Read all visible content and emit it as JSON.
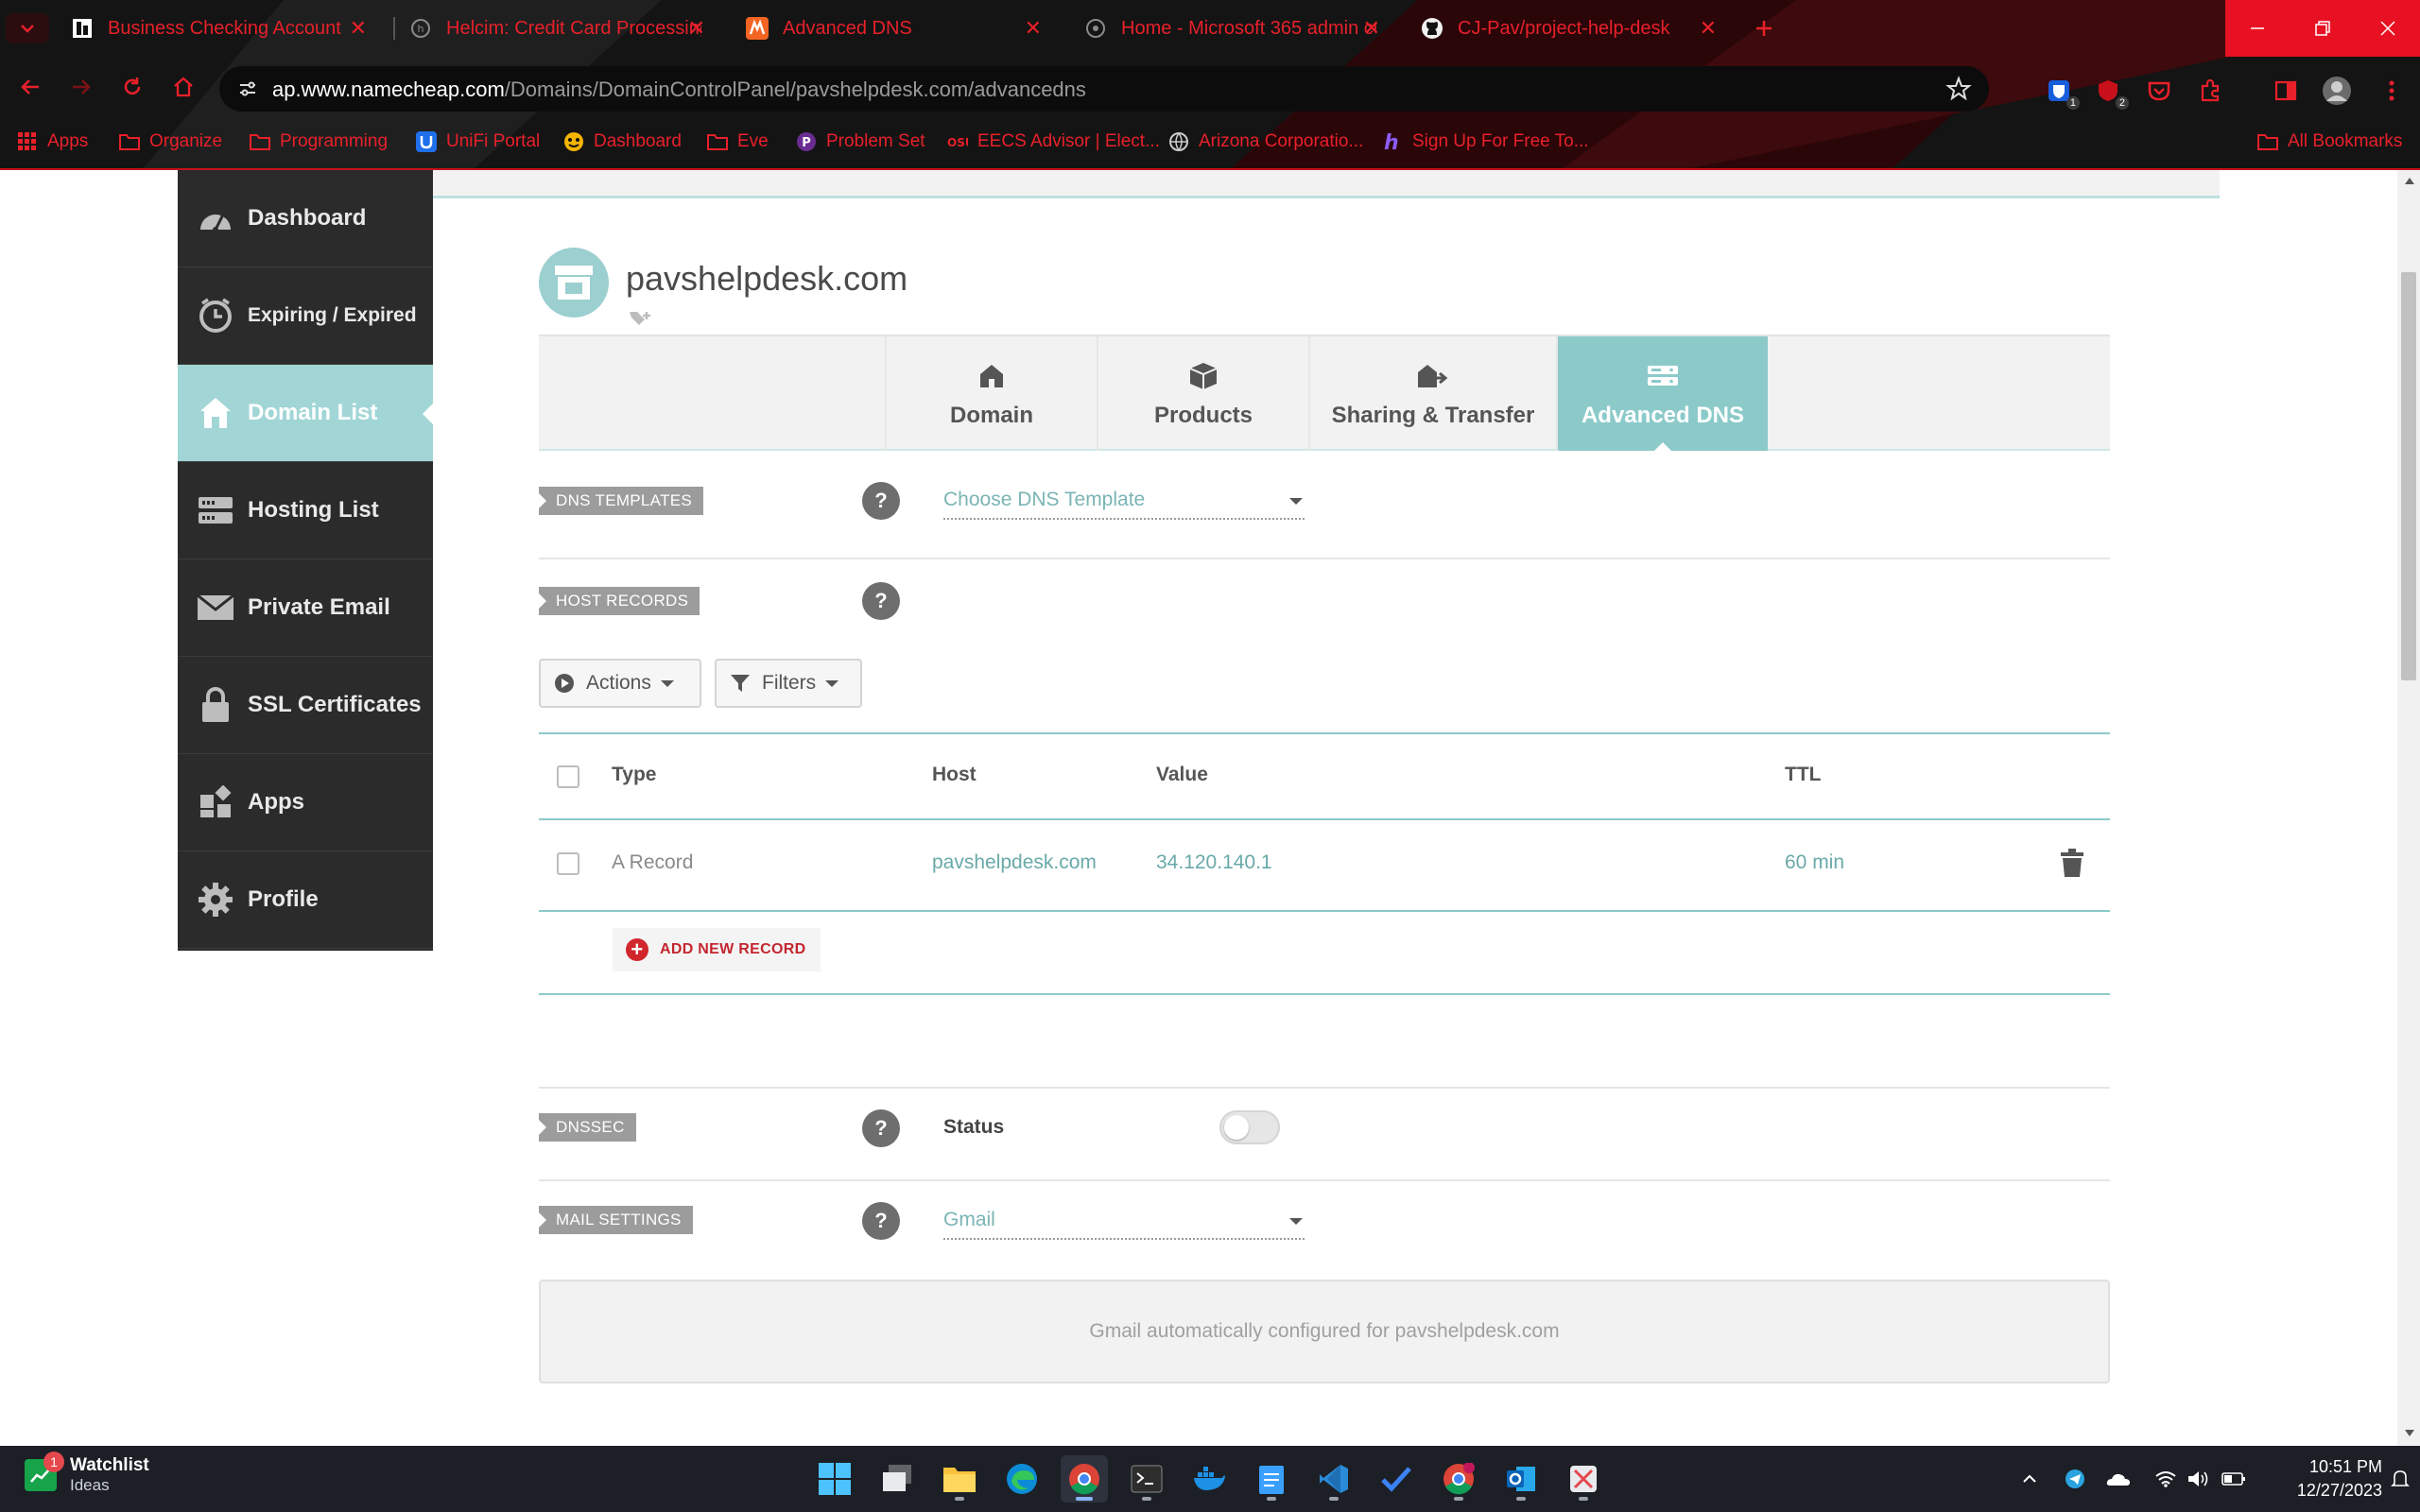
{
  "browser": {
    "tabs": [
      {
        "title": "Business Checking Account",
        "icon": "bank-favicon",
        "active": false
      },
      {
        "title": "Helcim: Credit Card Processing",
        "icon": "helcim-favicon",
        "active": false
      },
      {
        "title": "Advanced DNS",
        "icon": "namecheap-favicon",
        "active": true
      },
      {
        "title": "Home - Microsoft 365 admin ce",
        "icon": "microsoft-admin-favicon",
        "active": false
      },
      {
        "title": "CJ-Pav/project-help-desk",
        "icon": "github-favicon",
        "active": false
      }
    ],
    "url_host": "ap.www.namecheap.com",
    "url_path": "/Domains/DomainControlPanel/pavshelpdesk.com/advancedns",
    "extension_badges": [
      "1",
      "2"
    ],
    "bookmarks": [
      {
        "label": "Apps",
        "icon": "apps-grid-icon"
      },
      {
        "label": "Organize",
        "icon": "folder-icon"
      },
      {
        "label": "Programming",
        "icon": "folder-icon"
      },
      {
        "label": "UniFi Portal",
        "icon": "unifi-icon"
      },
      {
        "label": "Dashboard",
        "icon": "dashboard-icon"
      },
      {
        "label": "Eve",
        "icon": "folder-icon"
      },
      {
        "label": "Problem Set",
        "icon": "problem-set-icon"
      },
      {
        "label": "EECS Advisor | Elect...",
        "icon": "osu-icon"
      },
      {
        "label": "Arizona Corporatio...",
        "icon": "globe-icon"
      },
      {
        "label": "Sign Up For Free To...",
        "icon": "h-icon"
      }
    ],
    "all_bookmarks": "All Bookmarks",
    "accent_color": "#e8202a"
  },
  "sidebar": {
    "items": [
      {
        "label": "Dashboard",
        "icon": "speedometer-icon",
        "active": false
      },
      {
        "label": "Expiring / Expired",
        "icon": "clock-icon",
        "active": false
      },
      {
        "label": "Domain List",
        "icon": "home-icon",
        "active": true
      },
      {
        "label": "Hosting List",
        "icon": "server-icon",
        "active": false
      },
      {
        "label": "Private Email",
        "icon": "envelope-icon",
        "active": false
      },
      {
        "label": "SSL Certificates",
        "icon": "lock-icon",
        "active": false
      },
      {
        "label": "Apps",
        "icon": "apps-icon",
        "active": false
      },
      {
        "label": "Profile",
        "icon": "gear-icon",
        "active": false
      }
    ]
  },
  "domain": {
    "name": "pavshelpdesk.com",
    "tabs": [
      {
        "label": "Domain",
        "icon": "house-icon"
      },
      {
        "label": "Products",
        "icon": "box-icon"
      },
      {
        "label": "Sharing & Transfer",
        "icon": "share-icon"
      },
      {
        "label": "Advanced DNS",
        "icon": "dns-server-icon"
      }
    ],
    "active_tab": "Advanced DNS"
  },
  "dns_templates": {
    "label": "DNS TEMPLATES",
    "select_value": "Choose DNS Template"
  },
  "host_records": {
    "label": "HOST RECORDS",
    "actions_label": "Actions",
    "filters_label": "Filters",
    "columns": [
      "Type",
      "Host",
      "Value",
      "TTL"
    ],
    "rows": [
      {
        "type": "A Record",
        "host": "pavshelpdesk.com",
        "value": "34.120.140.1",
        "ttl": "60 min"
      }
    ],
    "add_label": "ADD NEW RECORD"
  },
  "dnssec": {
    "label": "DNSSEC",
    "status_label": "Status",
    "enabled": false
  },
  "mail_settings": {
    "label": "MAIL SETTINGS",
    "select_value": "Gmail",
    "info_text": "Gmail automatically configured for pavshelpdesk.com"
  },
  "taskbar": {
    "widget_title": "Watchlist",
    "widget_subtitle": "Ideas",
    "widget_badge": "1",
    "time": "10:51 PM",
    "date": "12/27/2023"
  },
  "colors": {
    "teal": "#8ccaca",
    "sidebar_bg": "#2b2b2b",
    "add_record_red": "#d0262c"
  }
}
